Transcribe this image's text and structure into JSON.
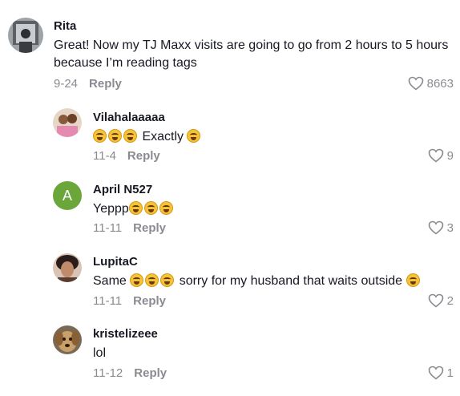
{
  "reply_label": "Reply",
  "comments": [
    {
      "user": "Rita",
      "text": "Great! Now my TJ Maxx visits are going to go from 2 hours to 5 hours because I’m reading tags",
      "date": "9-24",
      "likes": "8663"
    }
  ],
  "replies": [
    {
      "user": "Vilahalaaaaa",
      "text_after": "Exactly",
      "date": "11-4",
      "likes": "9"
    },
    {
      "user": "April N527",
      "avatar_letter": "A",
      "text_before": "Yeppp",
      "date": "11-11",
      "likes": "3"
    },
    {
      "user": "LupitaC",
      "text_before": "Same",
      "text_mid": "sorry for my husband that waits outside",
      "date": "11-11",
      "likes": "2"
    },
    {
      "user": "kristelizeee",
      "text": "lol",
      "date": "11-12",
      "likes": "1"
    }
  ],
  "colors": {
    "meta": "#8a8b91",
    "text": "#161823",
    "letter_avatar": "#6aa63a"
  }
}
